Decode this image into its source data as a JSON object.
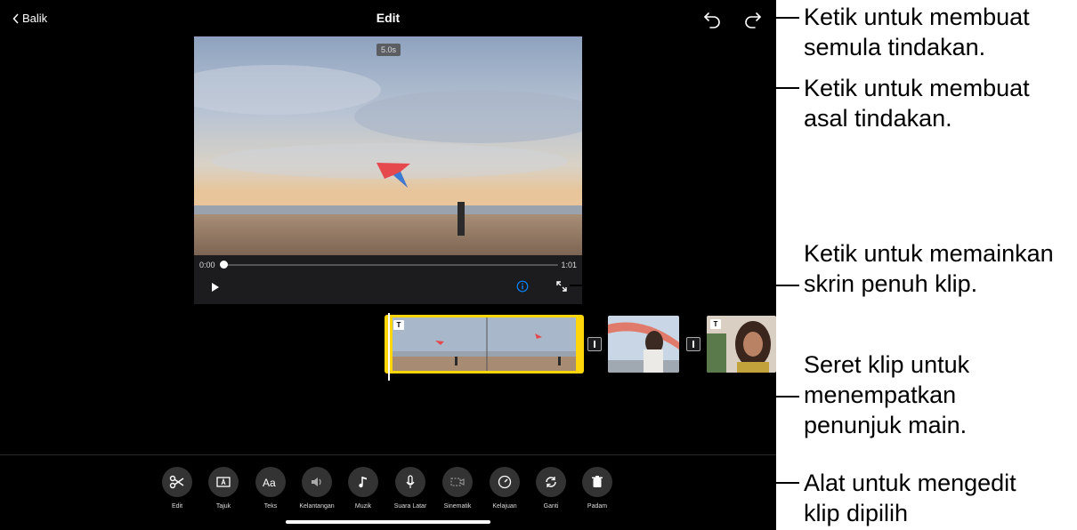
{
  "nav": {
    "back_label": "Balik",
    "title": "Edit"
  },
  "viewer": {
    "duration_badge": "5.0s",
    "time_start": "0:00",
    "time_end": "1:01",
    "progress": 0.0
  },
  "timeline": {
    "title_badge": "T",
    "transition_icon": "transition-icon"
  },
  "toolbar": {
    "tools": [
      {
        "label": "Edit",
        "icon": "scissors-icon"
      },
      {
        "label": "Tajuk",
        "icon": "title-icon"
      },
      {
        "label": "Teks",
        "icon": "text-icon"
      },
      {
        "label": "Kelantangan",
        "icon": "volume-icon"
      },
      {
        "label": "Muzik",
        "icon": "music-icon"
      },
      {
        "label": "Suara Latar",
        "icon": "microphone-icon"
      },
      {
        "label": "Sinematik",
        "icon": "cinematic-icon"
      },
      {
        "label": "Kelajuan",
        "icon": "speed-icon"
      },
      {
        "label": "Ganti",
        "icon": "replace-icon"
      },
      {
        "label": "Padam",
        "icon": "trash-icon"
      }
    ]
  },
  "callouts": {
    "undo_1": "Ketik untuk membuat",
    "undo_2": "semula tindakan.",
    "redo_1": "Ketik untuk membuat",
    "redo_2": "asal tindakan.",
    "full_1": "Ketik untuk memainkan",
    "full_2": "skrin penuh klip.",
    "drag_1": "Seret klip untuk",
    "drag_2": "menempatkan",
    "drag_3": "penunjuk main.",
    "tools_1": "Alat untuk mengedit",
    "tools_2": "klip dipilih"
  },
  "colors": {
    "accent_yellow": "#ffd60a",
    "info_blue": "#0a84ff"
  }
}
